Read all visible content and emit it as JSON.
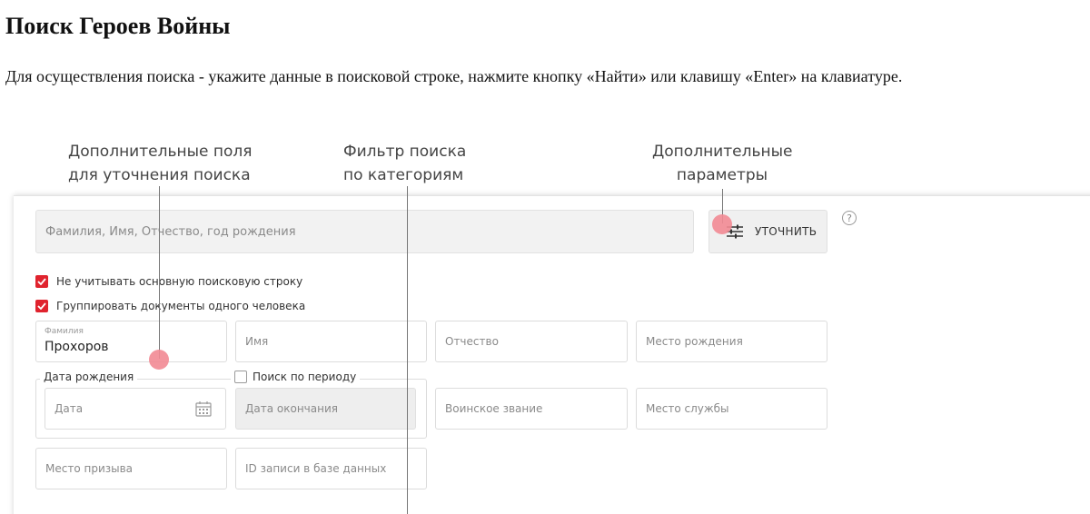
{
  "page": {
    "title": "Поиск Героев Войны",
    "instructions": "Для осуществления поиска - укажите данные в поисковой строке, нажмите кнопку «Найти» или клавишу «Enter» на клавиатуре."
  },
  "callouts": {
    "extra_fields": "Дополнительные поля\nдля уточнения поиска",
    "category_filter": "Фильтр поиска\nпо категориям",
    "extra_params": "Дополнительные\nпараметры"
  },
  "search": {
    "placeholder": "Фамилия, Имя, Отчество, год рождения",
    "refine_label": "УТОЧНИТЬ",
    "help_icon": "?"
  },
  "options": {
    "ignore_main": {
      "label": "Не учитывать основную поисковую строку",
      "checked": true
    },
    "group_docs": {
      "label": "Группировать документы одного человека",
      "checked": true
    }
  },
  "fields": {
    "surname": {
      "label": "Фамилия",
      "value": "Прохоров"
    },
    "name": {
      "placeholder": "Имя"
    },
    "patronymic": {
      "placeholder": "Отчество"
    },
    "birth_place": {
      "placeholder": "Место рождения"
    },
    "birth_date_group": "Дата рождения",
    "date": {
      "placeholder": "Дата"
    },
    "period_label": "Поиск по периоду",
    "end_date": {
      "placeholder": "Дата окончания"
    },
    "rank": {
      "placeholder": "Воинское звание"
    },
    "service_place": {
      "placeholder": "Место службы"
    },
    "draft_place": {
      "placeholder": "Место призыва"
    },
    "record_id": {
      "placeholder": "ID записи в базе данных"
    }
  },
  "icons": {
    "refine": "sliders-icon",
    "calendar": "calendar-icon",
    "help": "question-icon"
  },
  "colors": {
    "accent": "#e0232e",
    "marker": "#f28a93"
  }
}
